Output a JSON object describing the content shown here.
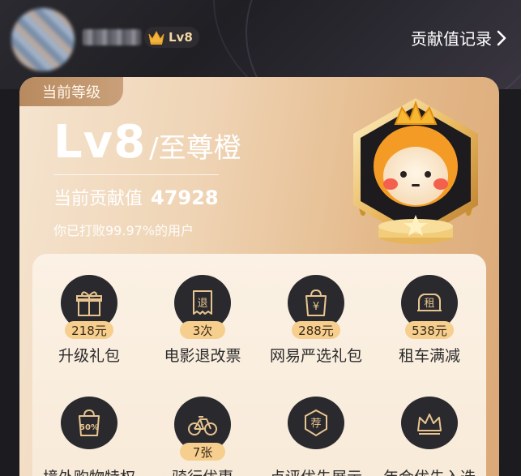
{
  "header": {
    "level_badge": "Lv8",
    "record_link": "贡献值记录"
  },
  "card": {
    "level_tag": "当前等级",
    "level_code": "Lv8",
    "level_name": "/至尊橙",
    "contribution_label": "当前贡献值",
    "contribution_value": "47928",
    "beat_text": "你已打败99.97%的用户"
  },
  "benefits": [
    {
      "label": "升级礼包",
      "value": "218元",
      "icon": "gift-icon"
    },
    {
      "label": "电影退改票",
      "value": "3次",
      "icon": "ticket-icon"
    },
    {
      "label": "网易严选礼包",
      "value": "288元",
      "icon": "shopping-bag-yen-icon"
    },
    {
      "label": "租车满减",
      "value": "538元",
      "icon": "car-rent-icon"
    },
    {
      "label": "境外购物特权",
      "value": "",
      "icon": "discount-bag-icon"
    },
    {
      "label": "骑行优惠",
      "value": "7张",
      "icon": "bicycle-icon"
    },
    {
      "label": "点评优先展示",
      "value": "",
      "icon": "recommend-badge-icon"
    },
    {
      "label": "年会优先入选",
      "value": "",
      "icon": "crown-icon"
    }
  ],
  "icon_glyphs": {
    "ticket": "退",
    "rent": "租",
    "discount": "50%",
    "recommend": "荐",
    "yen": "¥"
  },
  "colors": {
    "accent_gold": "#f6cf8e",
    "card_gradient_start": "#f5e4cf",
    "card_gradient_end": "#dba877",
    "icon_circle": "#2a2a2e"
  }
}
